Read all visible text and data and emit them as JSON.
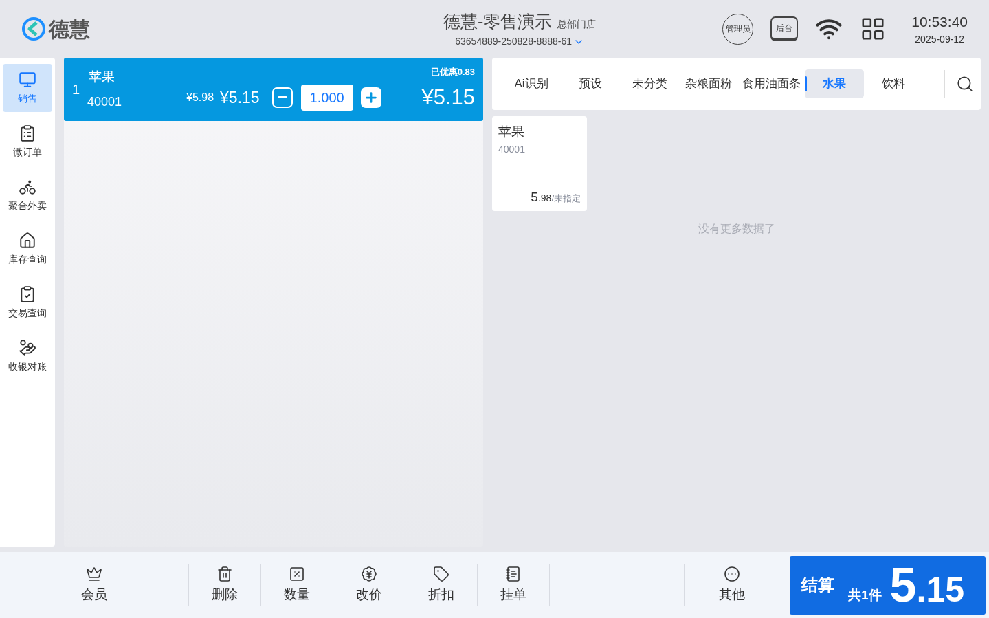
{
  "header": {
    "logo_text": "德慧",
    "store_title": "德慧-零售演示",
    "store_branch": "总部门店",
    "device_id": "63654889-250828-8888-61",
    "admin_badge": "管理员",
    "backend_label": "后台",
    "time": "10:53:40",
    "date": "2025-09-12"
  },
  "sidebar": {
    "items": [
      {
        "label": "销售",
        "selected": true
      },
      {
        "label": "微订单",
        "selected": false
      },
      {
        "label": "聚合外卖",
        "selected": false
      },
      {
        "label": "库存查询",
        "selected": false
      },
      {
        "label": "交易查询",
        "selected": false
      },
      {
        "label": "收银对账",
        "selected": false
      }
    ]
  },
  "cart": {
    "items": [
      {
        "index": "1",
        "name": "苹果",
        "code": "40001",
        "original_price": "¥5.98",
        "price": "¥5.15",
        "quantity": "1.000",
        "discount_note": "已优惠0.83",
        "subtotal": "¥5.15",
        "selected": true
      }
    ]
  },
  "categories": [
    {
      "label": "Ai识别",
      "selected": false
    },
    {
      "label": "预设",
      "selected": false
    },
    {
      "label": "未分类",
      "selected": false
    },
    {
      "label": "杂粮面粉",
      "selected": false
    },
    {
      "label": "食用油面条",
      "selected": false
    },
    {
      "label": "水果",
      "selected": true
    },
    {
      "label": "饮料",
      "selected": false
    }
  ],
  "products": [
    {
      "name": "苹果",
      "code": "40001",
      "price_integer": "5",
      "price_decimal": ".98",
      "unit": "/未指定"
    }
  ],
  "no_more_text": "没有更多数据了",
  "toolbar": {
    "buttons": [
      {
        "label": "会员"
      },
      {
        "label": "删除"
      },
      {
        "label": "数量"
      },
      {
        "label": "改价"
      },
      {
        "label": "折扣"
      },
      {
        "label": "挂单"
      }
    ],
    "end_buttons": [
      {
        "label": "其他"
      }
    ]
  },
  "checkout": {
    "label": "结算",
    "count": "共1件",
    "total_integer": "5",
    "total_decimal": ".15"
  }
}
